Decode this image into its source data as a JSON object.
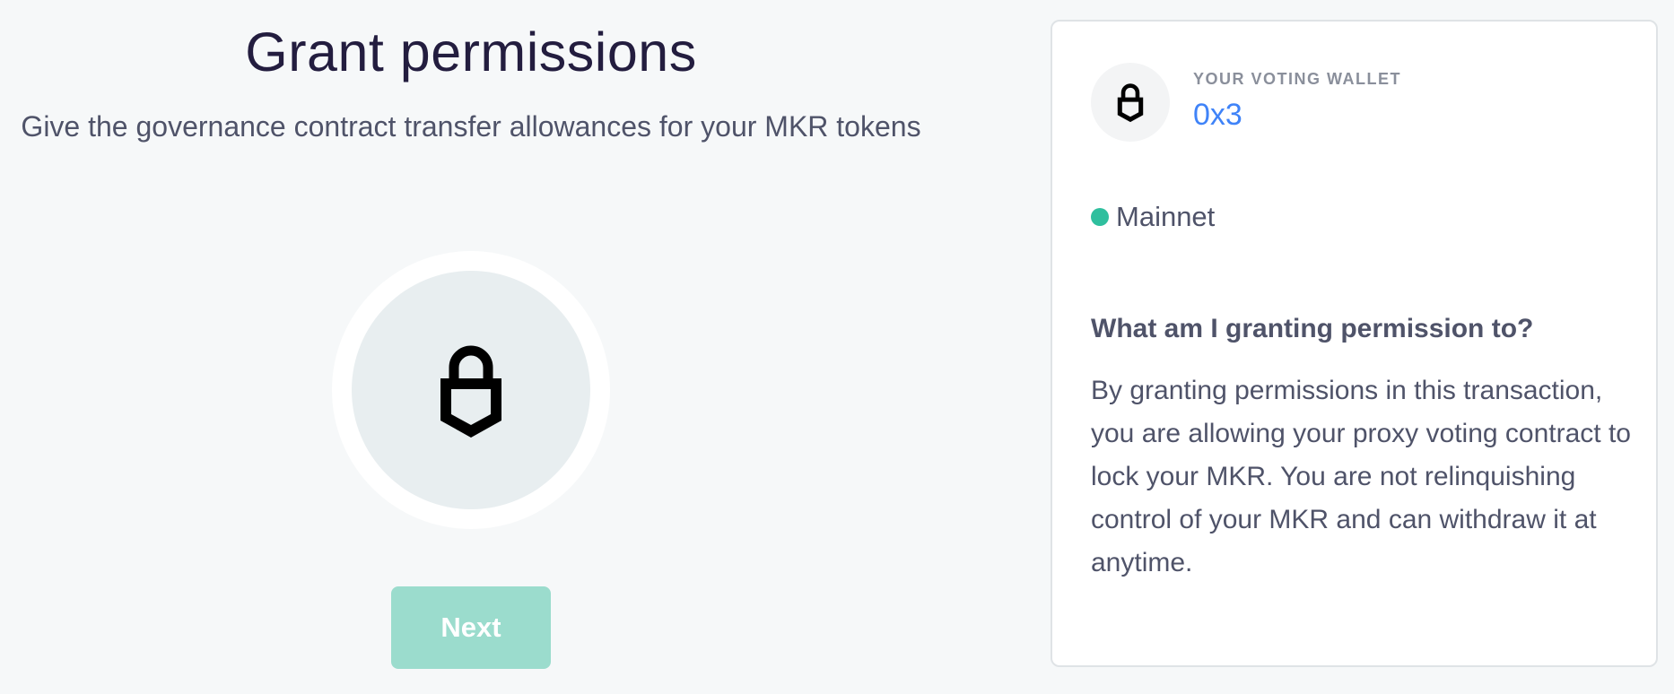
{
  "main": {
    "title": "Grant permissions",
    "subtitle": "Give the governance contract transfer allowances for your MKR tokens",
    "illustration_icon": "lock-icon",
    "next_label": "Next"
  },
  "sidebar": {
    "wallet_icon": "lock-icon",
    "wallet_label": "YOUR VOTING WALLET",
    "wallet_address": "0x3",
    "network_label": "Mainnet",
    "network_status_color": "#2fbf9e",
    "faq_question": "What am I granting permission to?",
    "faq_answer": "By granting permissions in this transaction, you are allowing your proxy voting contract to lock your MKR. You are not relinquishing control of your MKR and can withdraw it at anytime."
  },
  "colors": {
    "background": "#f6f8f9",
    "title": "#231d3f",
    "body_text": "#4f5369",
    "accent_link": "#3f83f8",
    "button_disabled": "#9bdccd"
  }
}
